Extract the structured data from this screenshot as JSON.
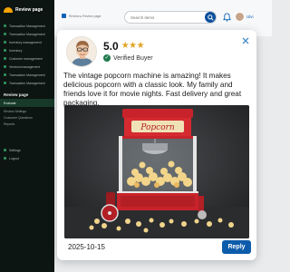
{
  "sidebar": {
    "brand": "Review page",
    "items": [
      {
        "label": "Transaction Management"
      },
      {
        "label": "Transaction Management"
      },
      {
        "label": "Inventory management"
      },
      {
        "label": "Inventory"
      },
      {
        "label": "Customer management"
      },
      {
        "label": "Vendors/management"
      },
      {
        "label": "Transaction Management"
      },
      {
        "label": "Transaction Management"
      }
    ],
    "section": "Review page",
    "section_item": "Evaluate",
    "bottom": [
      {
        "label": "Settings"
      },
      {
        "label": "Logout"
      }
    ],
    "sub_items": [
      "Review Settings",
      "Customer Questions",
      "Reports"
    ]
  },
  "topbar": {
    "breadcrumb": "Review ▸ Review page",
    "search_placeholder": "Search items",
    "user_name": "Ulvi"
  },
  "review": {
    "rating_value": "5.0",
    "stars": "★★★",
    "verified_label": "Verified Buyer",
    "text": "The vintage popcorn machine is amazing! It makes delicious popcorn with a classic look. My family and friends love it for movie nights. Fast delivery and great packaging.",
    "photo_sign": "Popcorn",
    "date": "2025-10-15",
    "reply_label": "Reply"
  },
  "colors": {
    "accent": "#0d5cab",
    "star": "#e3a526",
    "verified": "#1f7a4d",
    "sidebar_bg": "#0d1512"
  }
}
